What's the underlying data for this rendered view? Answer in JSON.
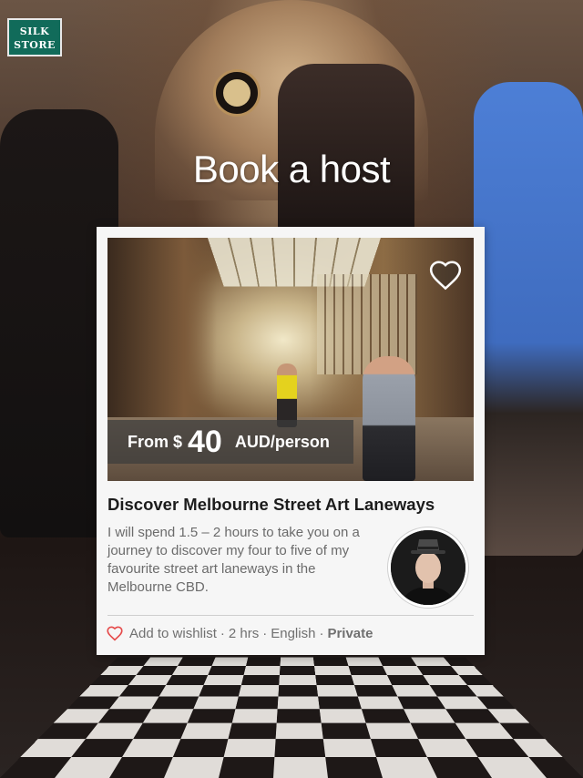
{
  "header": {
    "title": "Book a host"
  },
  "background": {
    "sign_text": "SILK\nSTORE"
  },
  "listing": {
    "price_prefix": "From $",
    "price_amount": "40",
    "price_unit": "AUD/person",
    "title": "Discover Melbourne Street Art Laneways",
    "description": "I will spend 1.5 – 2 hours to take you on a journey to discover my four to five of my favourite street art laneways in the Melbourne CBD.",
    "wishlist_label": "Add to wishlist",
    "duration": "2 hrs",
    "language": "English",
    "privacy": "Private",
    "separator": "·",
    "favorite_icon": "heart-outline-icon",
    "wishlist_icon": "heart-outline-icon"
  },
  "colors": {
    "wishlist_heart": "#e54b4b",
    "card_background": "#f6f6f6",
    "title_text": "#1c1c1c",
    "muted_text": "#707070"
  }
}
